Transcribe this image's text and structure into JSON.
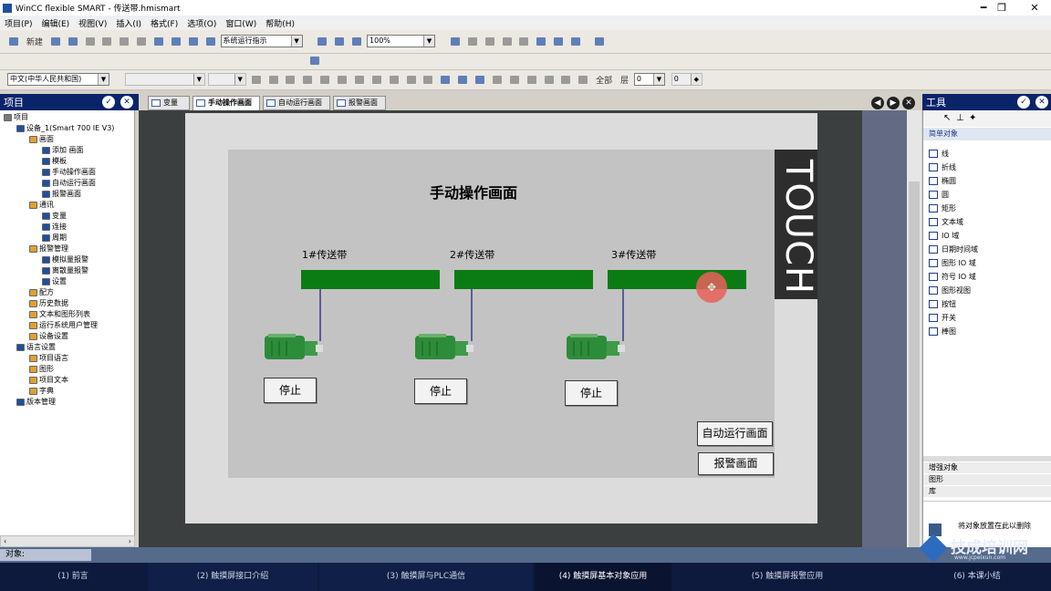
{
  "window": {
    "title": "WinCC flexible SMART - 传送带.hmismart",
    "min": "━",
    "max": "❐",
    "close": "✕"
  },
  "menu": [
    "项目(P)",
    "编辑(E)",
    "视图(V)",
    "插入(I)",
    "格式(F)",
    "选项(O)",
    "窗口(W)",
    "帮助(H)"
  ],
  "toolbar": {
    "new_label": "新建",
    "runtime_combo": "系统运行指示",
    "zoom": "100%",
    "language_combo": "中文(中华人民共和国)",
    "all_label": "全部",
    "layer_label": "层",
    "layer_value": "0",
    "spin_value": "0"
  },
  "project_panel": {
    "title": "项目",
    "items": [
      {
        "label": "项目",
        "indent": 0
      },
      {
        "label": "设备_1(Smart 700 IE V3)",
        "indent": 1
      },
      {
        "label": "画面",
        "indent": 2
      },
      {
        "label": "添加 画面",
        "indent": 3
      },
      {
        "label": "模板",
        "indent": 3
      },
      {
        "label": "手动操作画面",
        "indent": 3
      },
      {
        "label": "自动运行画面",
        "indent": 3
      },
      {
        "label": "报警画面",
        "indent": 3
      },
      {
        "label": "通讯",
        "indent": 2
      },
      {
        "label": "变量",
        "indent": 3
      },
      {
        "label": "连接",
        "indent": 3
      },
      {
        "label": "周期",
        "indent": 3
      },
      {
        "label": "报警管理",
        "indent": 2
      },
      {
        "label": "模拟量报警",
        "indent": 3
      },
      {
        "label": "离散量报警",
        "indent": 3
      },
      {
        "label": "设置",
        "indent": 3
      },
      {
        "label": "配方",
        "indent": 2
      },
      {
        "label": "历史数据",
        "indent": 2
      },
      {
        "label": "文本和图形列表",
        "indent": 2
      },
      {
        "label": "运行系统用户管理",
        "indent": 2
      },
      {
        "label": "设备设置",
        "indent": 2
      },
      {
        "label": "语言设置",
        "indent": 1
      },
      {
        "label": "项目语言",
        "indent": 2
      },
      {
        "label": "图形",
        "indent": 2
      },
      {
        "label": "项目文本",
        "indent": 2
      },
      {
        "label": "字典",
        "indent": 2
      },
      {
        "label": "版本管理",
        "indent": 1
      }
    ]
  },
  "tabs": [
    "变量",
    "手动操作画面",
    "自动运行画面",
    "报警画面"
  ],
  "screen": {
    "title": "手动操作画面",
    "belts": [
      "1#传送带",
      "2#传送带",
      "3#传送带"
    ],
    "stop_label": "停止",
    "auto_button": "自动运行画面",
    "alarm_button": "报警画面",
    "touch_label": "TOUCH"
  },
  "tools_panel": {
    "title": "工具",
    "section": "简单对象",
    "items": [
      "线",
      "折线",
      "椭圆",
      "圆",
      "矩形",
      "文本域",
      "IO 域",
      "日期时间域",
      "图形 IO 域",
      "符号 IO 域",
      "图形视图",
      "按钮",
      "开关",
      "棒图"
    ],
    "sections_bottom": [
      "增强对象",
      "图形",
      "库"
    ],
    "hint": "将对象放置在此以删除"
  },
  "objects_bar": {
    "label": "对象:"
  },
  "watermark": {
    "name": "技成培训网",
    "url": "www.jcpeixun.com"
  },
  "taskbar": [
    "(1) 前言",
    "(2) 触摸屏接口介绍",
    "(3) 触摸屏与PLC通信",
    "(4) 触摸屏基本对象应用",
    "(5) 触摸屏报警应用",
    "(6) 本课小结"
  ],
  "colors": {
    "belt": "#0b7c14",
    "panel_header": "#0a246a",
    "editor_bg": "#3b3f40",
    "screen_bg": "#c4c3c3",
    "cursor": "#e8615b"
  }
}
